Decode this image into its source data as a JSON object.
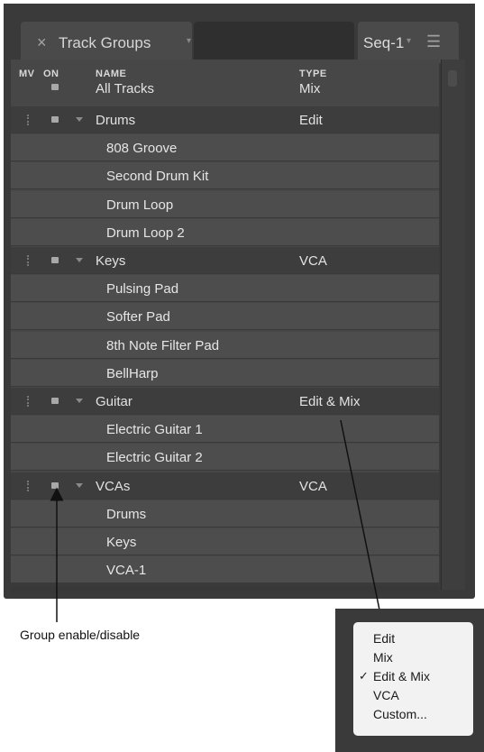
{
  "tabs": {
    "main": {
      "close": "×",
      "label": "Track Groups",
      "caret": "▾"
    },
    "seq": {
      "label": "Seq-1",
      "caret": "▾",
      "menu": "☰"
    }
  },
  "headers": {
    "mv": "MV",
    "on": "ON",
    "name": "NAME",
    "type": "TYPE"
  },
  "all_tracks": {
    "name": "All Tracks",
    "type": "Mix"
  },
  "rows": [
    {
      "kind": "parent",
      "name": "Drums",
      "type": "Edit"
    },
    {
      "kind": "child",
      "name": "808 Groove"
    },
    {
      "kind": "child",
      "name": "Second Drum Kit"
    },
    {
      "kind": "child",
      "name": "Drum Loop"
    },
    {
      "kind": "child",
      "name": "Drum Loop 2"
    },
    {
      "kind": "parent",
      "name": "Keys",
      "type": "VCA"
    },
    {
      "kind": "child",
      "name": "Pulsing Pad"
    },
    {
      "kind": "child",
      "name": "Softer Pad"
    },
    {
      "kind": "child",
      "name": "8th Note Filter Pad"
    },
    {
      "kind": "child",
      "name": "BellHarp"
    },
    {
      "kind": "parent",
      "name": "Guitar",
      "type": "Edit & Mix"
    },
    {
      "kind": "child",
      "name": "Electric Guitar 1"
    },
    {
      "kind": "child",
      "name": "Electric Guitar 2"
    },
    {
      "kind": "parent",
      "name": "VCAs",
      "type": "VCA"
    },
    {
      "kind": "child",
      "name": "Drums"
    },
    {
      "kind": "child",
      "name": "Keys"
    },
    {
      "kind": "child",
      "name": "VCA-1"
    }
  ],
  "callout": {
    "text": "Group enable/disable"
  },
  "type_menu": {
    "checkmark": "✓",
    "items": [
      "Edit",
      "Mix",
      "Edit & Mix",
      "VCA",
      "Custom..."
    ],
    "selected_index": 2
  }
}
